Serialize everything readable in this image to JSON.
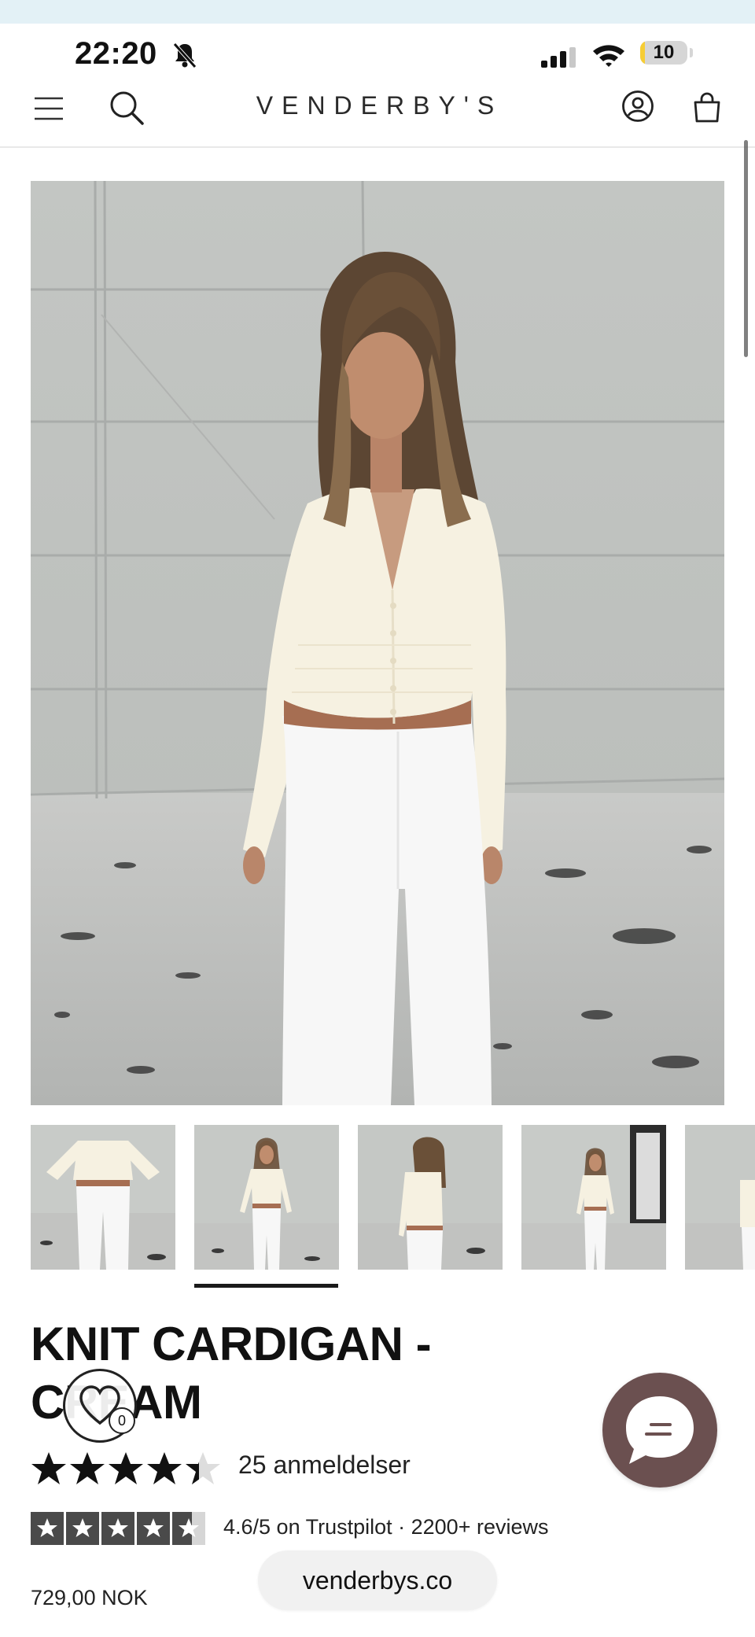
{
  "status_bar": {
    "time": "22:20",
    "battery": "10",
    "battery_level": 0.1
  },
  "header": {
    "brand": "VENDERBY'S"
  },
  "product": {
    "title": "KNIT CARDIGAN - CREAM",
    "rating_value": 4.6,
    "reviews_label": "25 anmeldelser",
    "trustpilot_label": "4.6/5 on Trustpilot · 2200+ reviews",
    "price": "729,00 NOK"
  },
  "gallery": {
    "thumbnail_count": 5,
    "active_index": 1
  },
  "wishlist": {
    "count": "0"
  },
  "browser": {
    "url": "venderbys.co"
  },
  "colors": {
    "accent": "#6b5050",
    "star": "#111111",
    "topstrip": "#e3f1f6",
    "cardigan": "#f6f1e1",
    "pants": "#f7f7f7"
  },
  "icons": [
    "menu-icon",
    "search-icon",
    "account-icon",
    "cart-icon",
    "bell-off-icon",
    "signal-icon",
    "wifi-icon",
    "heart-icon",
    "chat-icon",
    "star-icon"
  ]
}
